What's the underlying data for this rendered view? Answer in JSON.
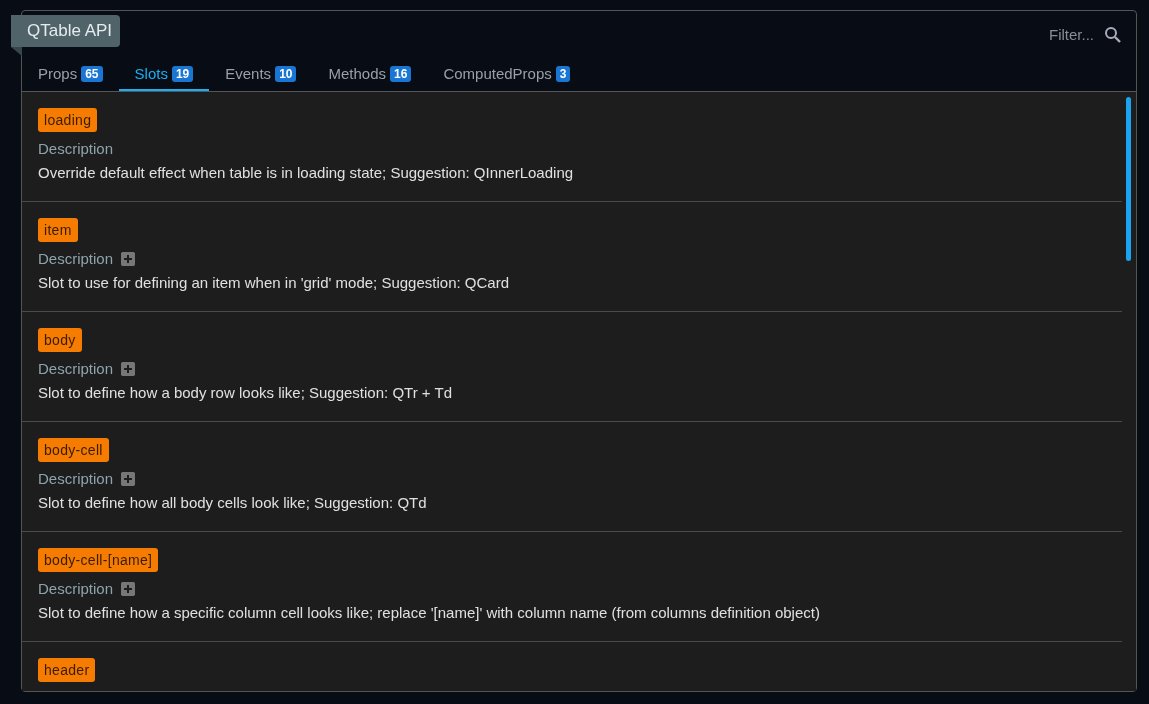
{
  "title": "QTable API",
  "filter": {
    "placeholder": "Filter..."
  },
  "tabs": [
    {
      "label": "Props",
      "count": "65",
      "selected": false
    },
    {
      "label": "Slots",
      "count": "19",
      "selected": true
    },
    {
      "label": "Events",
      "count": "10",
      "selected": false
    },
    {
      "label": "Methods",
      "count": "16",
      "selected": false
    },
    {
      "label": "ComputedProps",
      "count": "3",
      "selected": false
    }
  ],
  "slots": [
    {
      "name": "loading",
      "label": "Description",
      "expandable": false,
      "text": "Override default effect when table is in loading state; Suggestion: QInnerLoading"
    },
    {
      "name": "item",
      "label": "Description",
      "expandable": true,
      "text": "Slot to use for defining an item when in 'grid' mode; Suggestion: QCard"
    },
    {
      "name": "body",
      "label": "Description",
      "expandable": true,
      "text": "Slot to define how a body row looks like; Suggestion: QTr + Td"
    },
    {
      "name": "body-cell",
      "label": "Description",
      "expandable": true,
      "text": "Slot to define how all body cells look like; Suggestion: QTd"
    },
    {
      "name": "body-cell-[name]",
      "label": "Description",
      "expandable": true,
      "text": "Slot to define how a specific column cell looks like; replace '[name]' with column name (from columns definition object)"
    },
    {
      "name": "header"
    }
  ]
}
